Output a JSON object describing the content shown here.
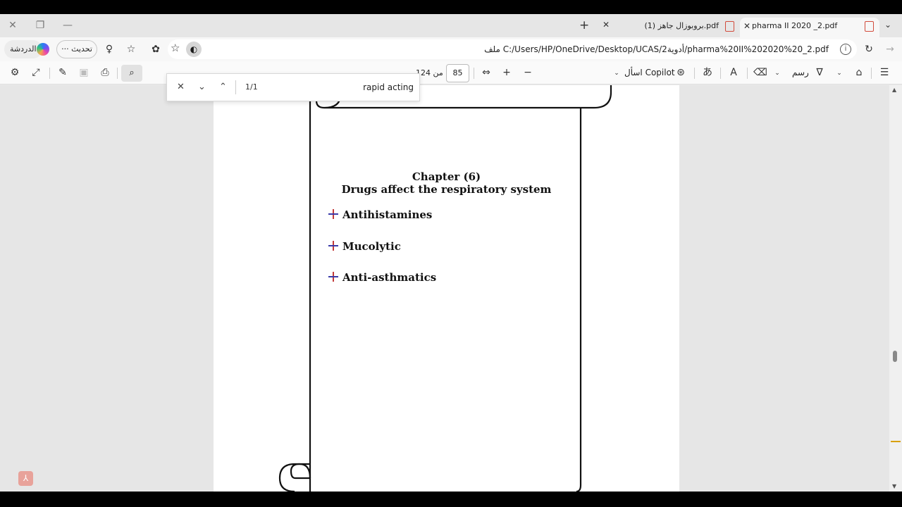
{
  "tabs": [
    {
      "title": "pharma II 2020 _2.pdf",
      "active": true
    },
    {
      "title": "بروبوزال جاهز (1).pdf",
      "active": false
    }
  ],
  "toolbar": {
    "chat_label": "الدردشة",
    "update_label": "تحديث",
    "url": "ملف   C:/Users/HP/OneDrive/Desktop/UCAS/أدوية2/pharma%20II%202020%20_2.pdf"
  },
  "pdf_toolbar": {
    "page_current": "85",
    "page_total": "من 124",
    "copilot_label": "اسأل Copilot",
    "draw_label": "رسم"
  },
  "find": {
    "query": "rapid acting",
    "count": "1/1"
  },
  "document": {
    "chapter": "Chapter (6)",
    "subtitle": "Drugs affect the respiratory system",
    "items": [
      "Antihistamines",
      "Mucolytic",
      "Anti-asthmatics"
    ]
  },
  "colors": {
    "accent": "#d24c3c",
    "scroll_marker": "#d9a000"
  }
}
